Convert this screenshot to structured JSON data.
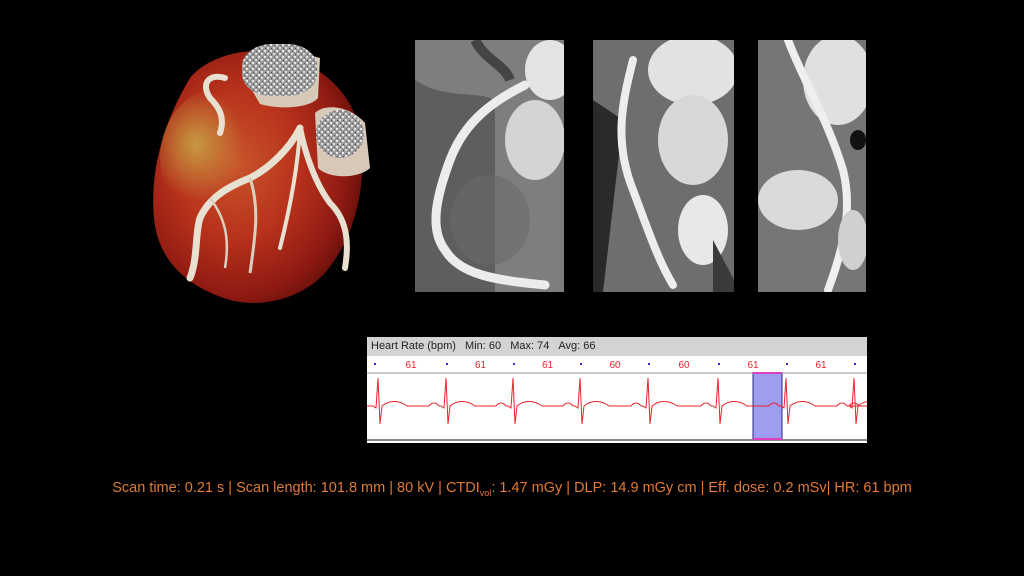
{
  "ecg": {
    "title": "Heart Rate (bpm)",
    "min_label": "Min: 60",
    "max_label": "Max: 74",
    "avg_label": "Avg: 66",
    "beat_rates": [
      "61",
      "61",
      "61",
      "60",
      "60",
      "61",
      "61"
    ],
    "trace_color": "#e8232a",
    "selection_color": "#9e9ef0",
    "selection_border": "#e040c0"
  },
  "info": {
    "scan_time": "Scan time: 0.21 s",
    "scan_length": "Scan length: 101.8 mm",
    "kv": "80 kV",
    "ctdi_prefix": "CTDI",
    "ctdi_sub": "vol",
    "ctdi_value": ": 1.47 mGy",
    "dlp": "DLP: 14.9 mGy cm",
    "eff_dose": "Eff. dose: 0.2 mSv",
    "hr": "HR: 61 bpm",
    "sep": " | ",
    "sep_tight": "| ",
    "color": "#e07a36"
  },
  "images": {
    "volume_render": "heart-volume-rendering",
    "panel_1": "coronary-cpr-view-1",
    "panel_2": "coronary-cpr-view-2",
    "panel_3": "coronary-cpr-view-3"
  }
}
